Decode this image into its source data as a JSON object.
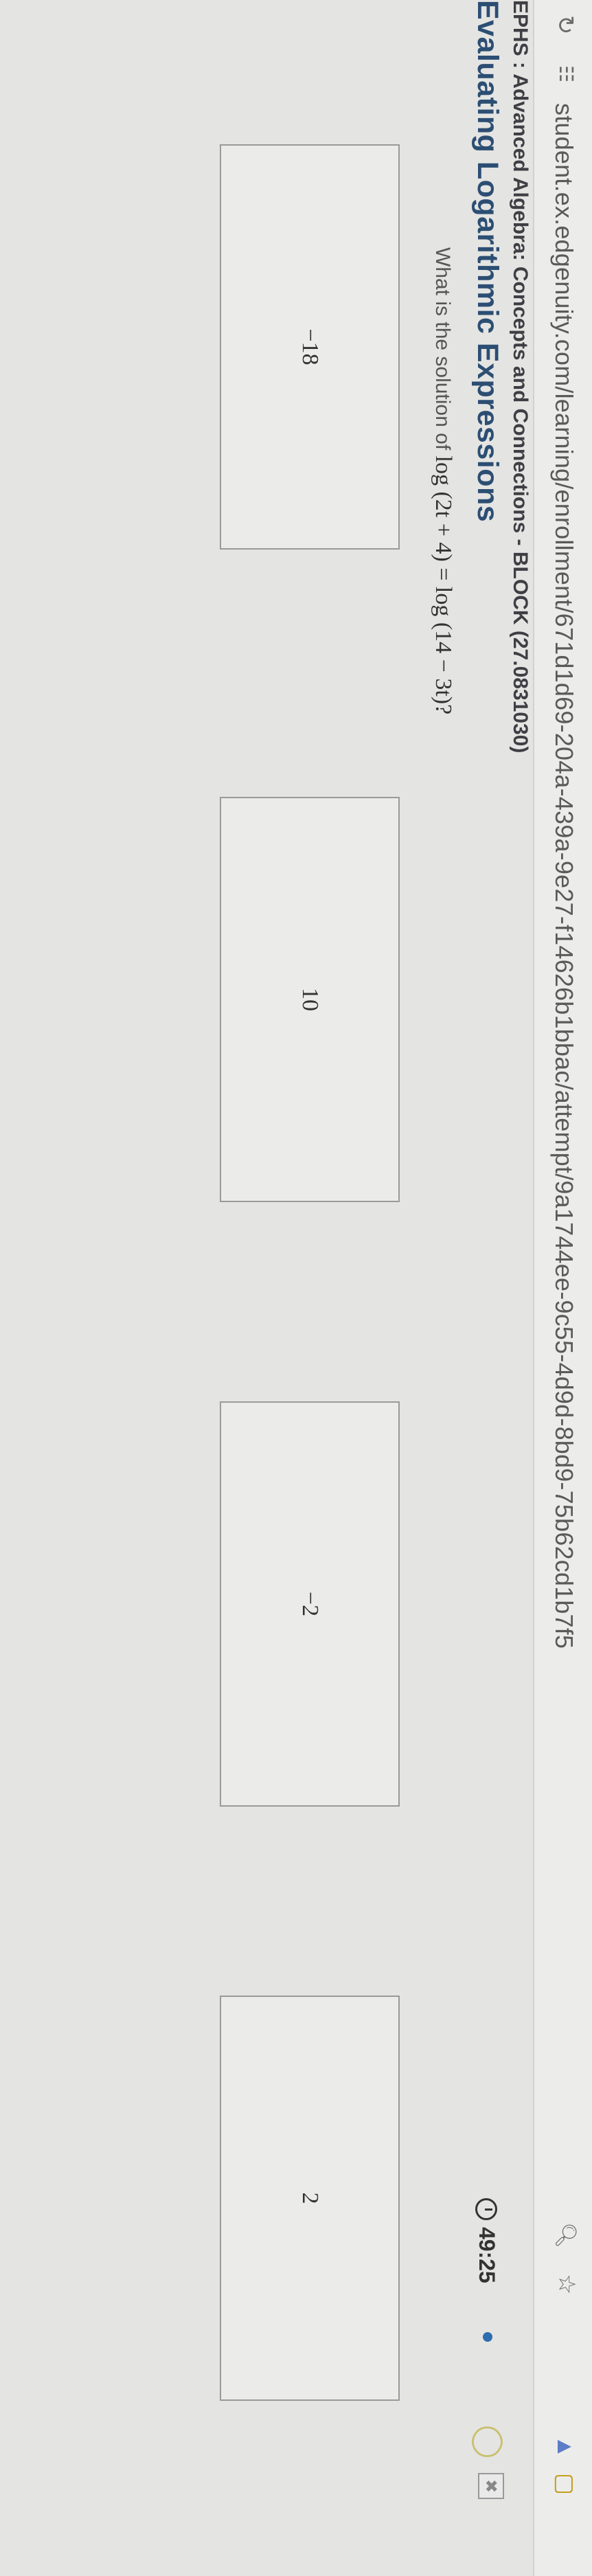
{
  "browser": {
    "url": "student.ex.edgenuity.com/learning/enrollment/671d1d69-204a-439a-9e27-f14626b1bbac/attempt/9a1744ee-9c55-4d9d-8bd9-75b62cd1b7f5"
  },
  "header": {
    "course": "EPHS : Advanced Algebra: Concepts and Connections - BLOCK (27.0831030)",
    "lesson": "Evaluating Logarithmic Expressions",
    "timer": "49:25"
  },
  "question": {
    "prompt": "What is the solution of",
    "expression": "log (2t + 4) = log (14 − 3t)?"
  },
  "choices": [
    {
      "label": "−18"
    },
    {
      "label": "10"
    },
    {
      "label": "−2"
    },
    {
      "label": "2"
    }
  ],
  "colors": {
    "lesson_title": "#2c4e73",
    "status_dot": "#2d6db0"
  },
  "icons": [
    "reload-icon",
    "site-info-icon",
    "zoom-icon",
    "bookmark-star-icon",
    "extension-icon",
    "hint-lightbulb-icon",
    "timer-icon",
    "tools-icon"
  ]
}
